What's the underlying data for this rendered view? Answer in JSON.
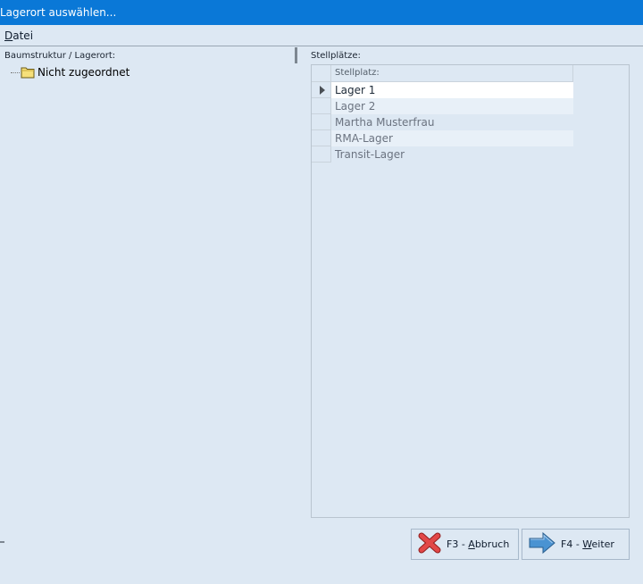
{
  "window": {
    "title": "Lagerort auswählen..."
  },
  "menu": {
    "items": [
      {
        "accel": "D",
        "rest": "atei"
      }
    ]
  },
  "tree": {
    "header": "Baumstruktur / Lagerort:",
    "nodes": [
      {
        "label": "Nicht zugeordnet",
        "icon": "folder-icon"
      }
    ]
  },
  "grid": {
    "label": "Stellplätze:",
    "column_header": "Stellplatz:",
    "rows": [
      {
        "label": "Lager 1",
        "selected": true
      },
      {
        "label": "Lager 2",
        "selected": false
      },
      {
        "label": "Martha Musterfrau",
        "selected": false
      },
      {
        "label": "RMA-Lager",
        "selected": false
      },
      {
        "label": "Transit-Lager",
        "selected": false
      }
    ]
  },
  "buttons": {
    "cancel": {
      "prefix": "F3 - ",
      "accel": "A",
      "rest": "bbruch",
      "icon": "red-x-icon"
    },
    "next": {
      "prefix": "F4 - ",
      "accel": "W",
      "rest": "eiter",
      "icon": "arrow-right-icon"
    }
  },
  "colors": {
    "titlebar": "#0a78d7",
    "background": "#dde8f3",
    "cancel_icon": "#d93a3a",
    "next_icon": "#3d86c6"
  }
}
